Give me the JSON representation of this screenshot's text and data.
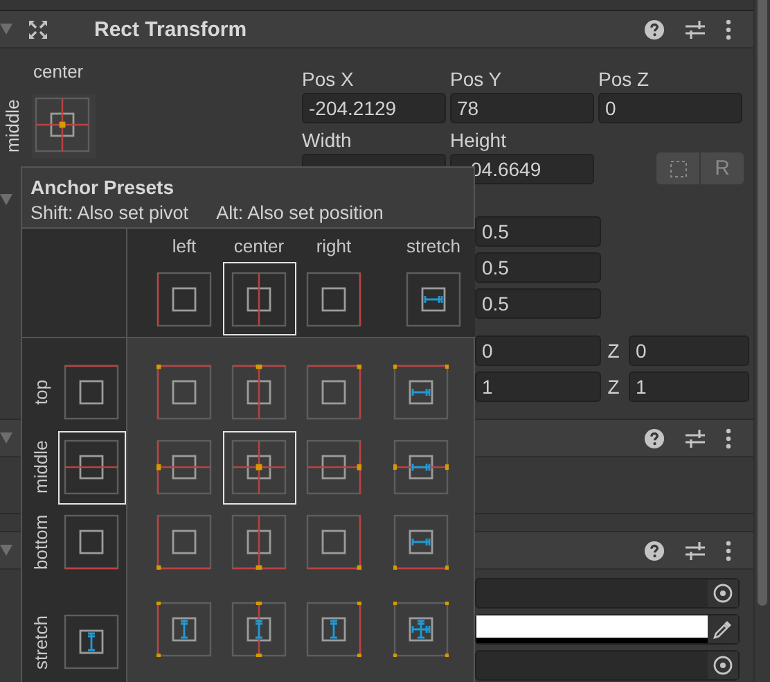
{
  "header": {
    "title": "Rect Transform",
    "expanded": true
  },
  "anchor": {
    "horizontal": "center",
    "vertical": "middle"
  },
  "position_fields": [
    {
      "label": "Pos X",
      "value": "-204.2129"
    },
    {
      "label": "Pos Y",
      "value": "78"
    },
    {
      "label": "Pos Z",
      "value": "0"
    }
  ],
  "size_fields": [
    {
      "label": "Width"
    },
    {
      "label": "Height",
      "value": "04.6649"
    }
  ],
  "raw_button": "R",
  "anchors_foldout": {
    "expanded": true
  },
  "values_column": [
    "0.5",
    "0.5",
    "0.5"
  ],
  "xyz_rows": [
    {
      "value": "0",
      "z_label": "Z",
      "z_value": "0"
    },
    {
      "value": "1",
      "z_label": "Z",
      "z_value": "1"
    }
  ],
  "components": [
    {
      "expanded": true
    },
    {
      "expanded": true
    }
  ],
  "anchor_presets": {
    "title": "Anchor Presets",
    "hint_shift": "Shift: Also set pivot",
    "hint_alt": "Alt: Also set position",
    "columns": [
      {
        "label": "left",
        "selected": false
      },
      {
        "label": "center",
        "selected": true
      },
      {
        "label": "right",
        "selected": false
      },
      {
        "label": "stretch",
        "selected": false
      }
    ],
    "rows": [
      {
        "label": "top",
        "selected": false
      },
      {
        "label": "middle",
        "selected": true
      },
      {
        "label": "bottom",
        "selected": false
      },
      {
        "label": "stretch",
        "selected": false
      }
    ],
    "cells": [
      [
        {
          "selected": false
        },
        {
          "selected": false
        },
        {
          "selected": false
        },
        {
          "selected": false
        }
      ],
      [
        {
          "selected": false
        },
        {
          "selected": true
        },
        {
          "selected": false
        },
        {
          "selected": false
        }
      ],
      [
        {
          "selected": false
        },
        {
          "selected": false
        },
        {
          "selected": false
        },
        {
          "selected": false
        }
      ],
      [
        {
          "selected": false
        },
        {
          "selected": false
        },
        {
          "selected": false
        },
        {
          "selected": false
        }
      ]
    ]
  }
}
